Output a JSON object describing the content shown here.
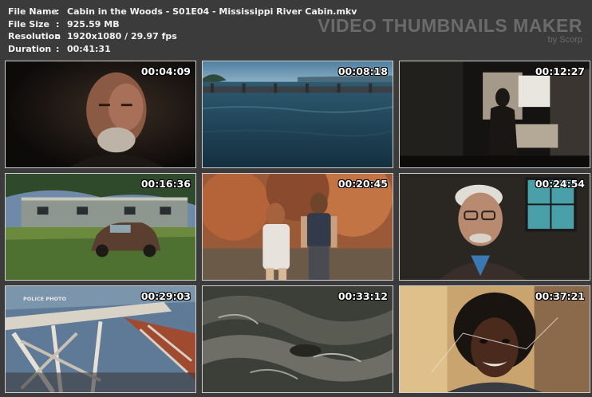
{
  "info": {
    "file_name_label": "File Name",
    "file_name": "Cabin in the Woods - S01E04 - Mississippi River Cabin.mkv",
    "file_size_label": "File Size",
    "file_size": "925.59 MB",
    "resolution_label": "Resolution",
    "resolution": "1920x1080 / 29.97 fps",
    "duration_label": "Duration",
    "duration": "00:41:31",
    "separator": ":"
  },
  "brand": {
    "title": "VIDEO THUMBNAILS MAKER",
    "subtitle": "by Scorp"
  },
  "thumbnails": [
    {
      "timestamp": "00:04:09",
      "scene": "old-man-portrait"
    },
    {
      "timestamp": "00:08:18",
      "scene": "river-lock-dam"
    },
    {
      "timestamp": "00:12:27",
      "scene": "woman-in-kitchen"
    },
    {
      "timestamp": "00:16:36",
      "scene": "mobile-home-rusty-car"
    },
    {
      "timestamp": "00:20:45",
      "scene": "two-kids-photo"
    },
    {
      "timestamp": "00:24:54",
      "scene": "old-man-glasses"
    },
    {
      "timestamp": "00:29:03",
      "scene": "police-photo-wreckage",
      "caption": "POLICE PHOTO"
    },
    {
      "timestamp": "00:33:12",
      "scene": "flood-water"
    },
    {
      "timestamp": "00:37:21",
      "scene": "girl-old-photo"
    }
  ]
}
